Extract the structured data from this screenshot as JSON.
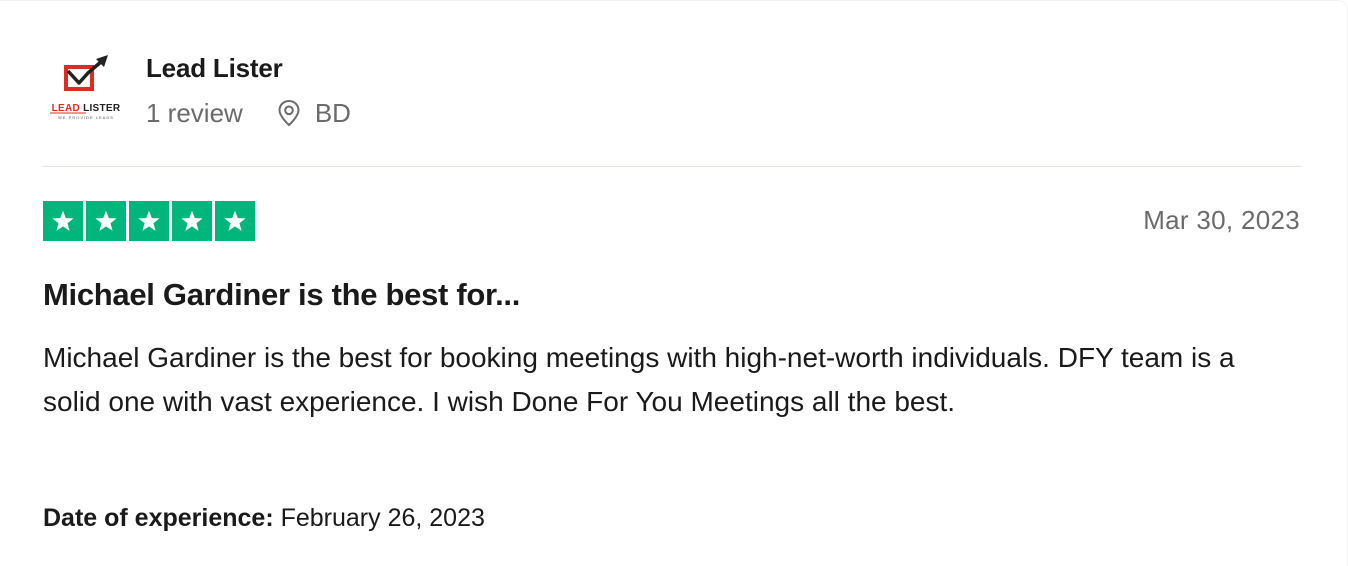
{
  "reviewer": {
    "name": "Lead Lister",
    "review_count": "1 review",
    "location": "BD",
    "avatar_icon": "lead-lister-logo",
    "avatar_text": "LEAD LISTER",
    "avatar_tagline": "WE PROVIDE LEADS"
  },
  "review": {
    "rating": 5,
    "rating_max": 5,
    "star_color": "#00b67a",
    "date": "Mar 30, 2023",
    "title": "Michael Gardiner is the best for...",
    "body": "Michael Gardiner is the best for booking meetings with high-net-worth individuals. DFY team is a solid one with vast experience. I wish Done For You Meetings all the best.",
    "experience_label": "Date of experience:",
    "experience_date": "February 26, 2023"
  }
}
